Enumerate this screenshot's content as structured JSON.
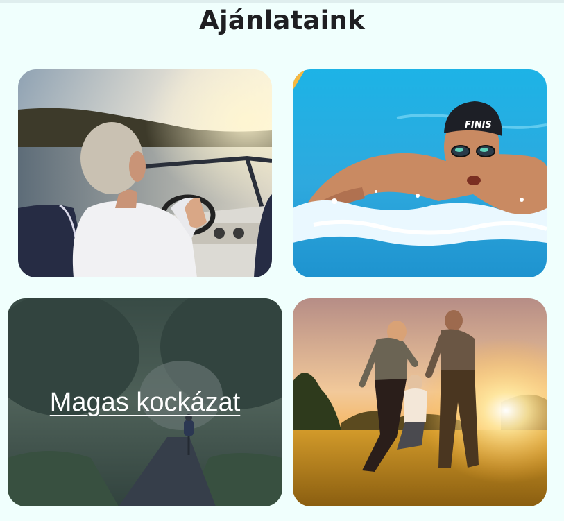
{
  "page": {
    "title": "Ajánlataink"
  },
  "cards": [
    {
      "image": "boat-driving-photo"
    },
    {
      "image": "swimmer-photo"
    },
    {
      "image": "cyclist-road-photo",
      "link_label": "Magas kockázat"
    },
    {
      "image": "family-sunset-photo"
    }
  ]
}
